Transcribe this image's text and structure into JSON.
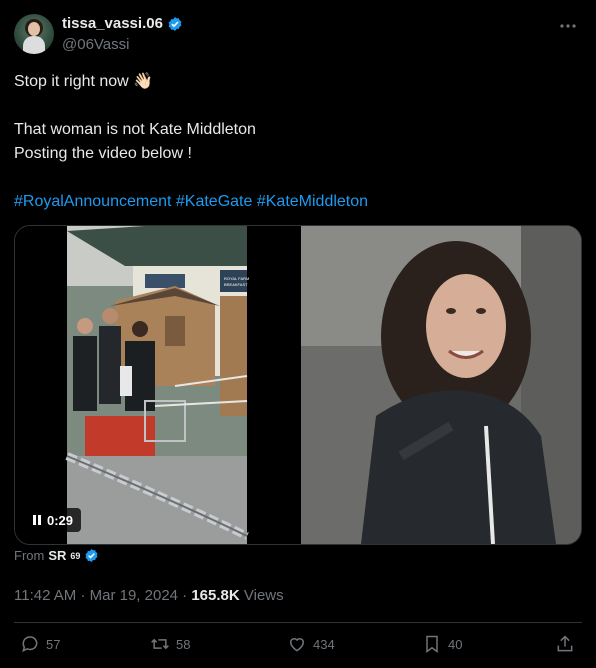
{
  "author": {
    "display_name": "tissa_vassi.06",
    "handle": "@06Vassi",
    "verified": true
  },
  "tweet": {
    "line1": "Stop it right now",
    "line1_emoji": "👋🏻",
    "line2": "That woman is not Kate Middleton",
    "line3": "Posting the video below !",
    "hashtags": [
      "#RoyalAnnouncement",
      "#KateGate",
      "#KateMiddleton"
    ]
  },
  "media": {
    "duration": "0:29",
    "sign_left": "ROYAL FARM",
    "sign_left_sub": "BREAKFAST"
  },
  "source": {
    "prefix": "From",
    "name": "SR",
    "superscript": "69"
  },
  "meta": {
    "time": "11:42 AM",
    "separator": "·",
    "date": "Mar 19, 2024",
    "views_count": "165.8K",
    "views_label": "Views"
  },
  "actions": {
    "replies": "57",
    "reposts": "58",
    "likes": "434",
    "bookmarks": "40"
  },
  "colors": {
    "accent": "#1d9bf0",
    "muted": "#71767b",
    "text": "#e7e9ea",
    "background": "#000000"
  }
}
